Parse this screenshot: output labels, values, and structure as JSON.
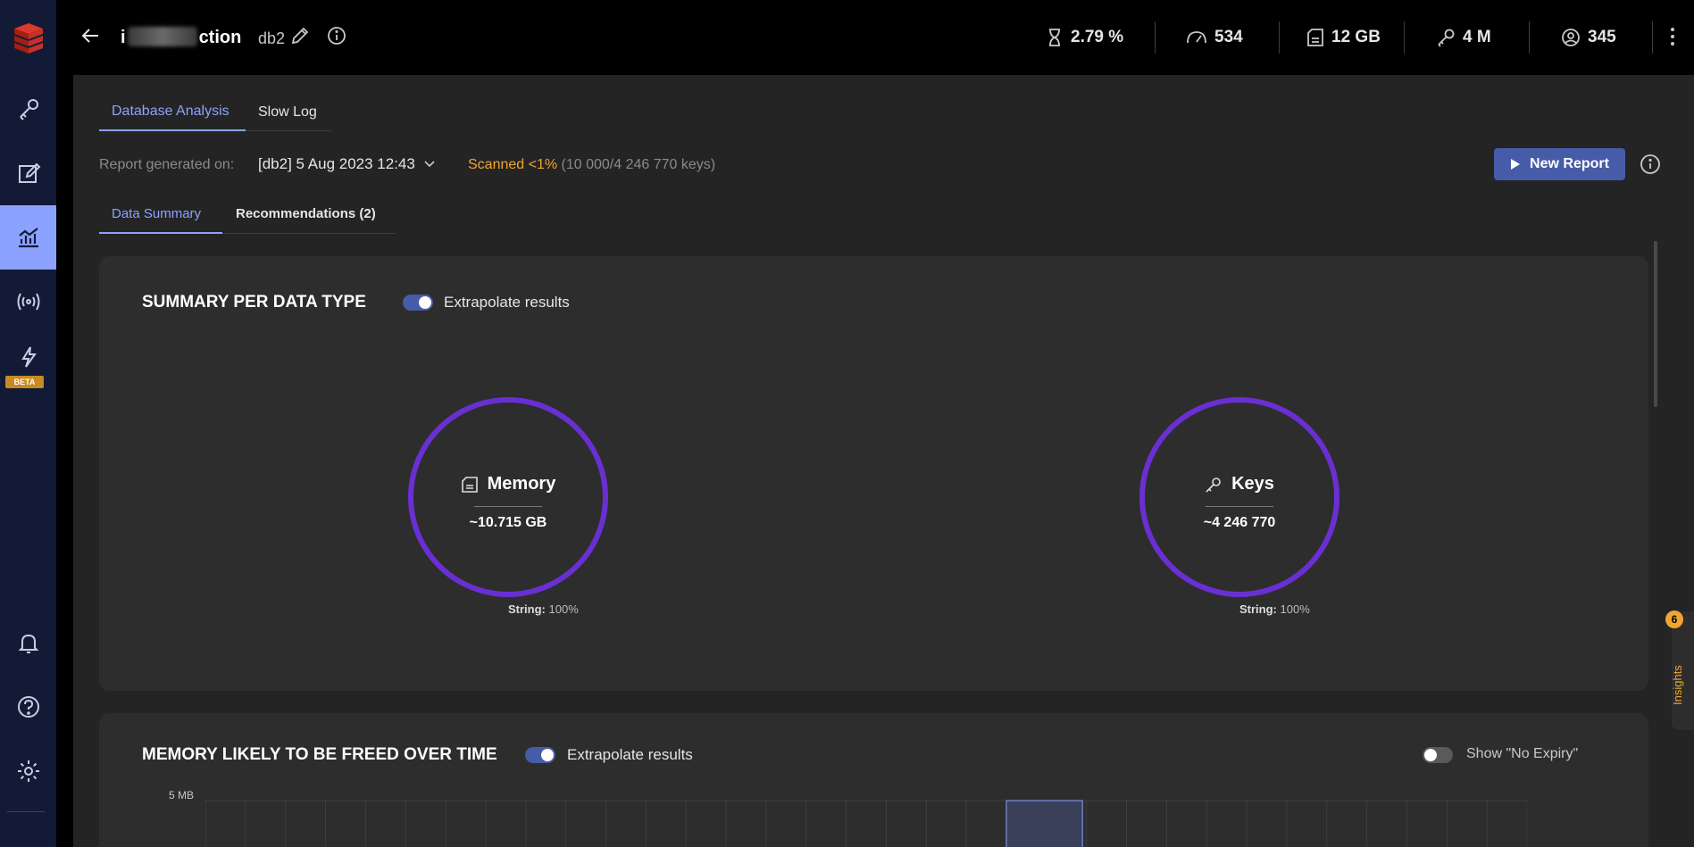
{
  "header": {
    "db_name_start": "i",
    "db_name_end": "ction",
    "db_index": "db2",
    "metrics": [
      {
        "icon": "cpu-icon",
        "value": "2.79 %"
      },
      {
        "icon": "speedometer-icon",
        "value": "534"
      },
      {
        "icon": "memory-icon",
        "value": "12 GB"
      },
      {
        "icon": "key-icon",
        "value": "4 M"
      },
      {
        "icon": "user-icon",
        "value": "345"
      }
    ]
  },
  "sidebar": {
    "beta_badge": "BETA",
    "items": [
      {
        "name": "browser",
        "icon": "key-icon"
      },
      {
        "name": "workbench",
        "icon": "edit-icon"
      },
      {
        "name": "analysis",
        "icon": "chart-icon",
        "active": true
      },
      {
        "name": "pubsub",
        "icon": "broadcast-icon"
      },
      {
        "name": "triggers",
        "icon": "lightning-icon"
      },
      {
        "name": "notifications",
        "icon": "bell-icon"
      },
      {
        "name": "help",
        "icon": "help-icon"
      },
      {
        "name": "settings",
        "icon": "gear-icon"
      }
    ]
  },
  "main": {
    "tabs": [
      {
        "label": "Database Analysis",
        "active": true
      },
      {
        "label": "Slow Log",
        "active": false
      }
    ],
    "report_label": "Report generated on:",
    "report_value": "[db2] 5 Aug 2023 12:43",
    "scanned_highlight": "Scanned <1%",
    "scanned_rest": "(10 000/4 246 770 keys)",
    "new_report_label": "New Report",
    "subtabs": [
      {
        "label": "Data Summary",
        "active": true
      },
      {
        "label": "Recommendations (2)",
        "active": false
      }
    ]
  },
  "summary_panel": {
    "title": "SUMMARY PER DATA TYPE",
    "toggle_label": "Extrapolate results",
    "toggle_on": true,
    "memory": {
      "title": "Memory",
      "value": "~10.715 GB",
      "caption_type": "String:",
      "caption_pct": "100%"
    },
    "keys": {
      "title": "Keys",
      "value": "~4 246 770",
      "caption_type": "String:",
      "caption_pct": "100%"
    },
    "ring_color": "#6a2fd3"
  },
  "memory_panel": {
    "title": "MEMORY LIKELY TO BE FREED OVER TIME",
    "toggle_label": "Extrapolate results",
    "toggle_on": true,
    "no_expiry_label": "Show \"No Expiry\"",
    "no_expiry_on": false,
    "y_axis_top_label": "5 MB"
  },
  "insights": {
    "badge": "6",
    "label": "Insights"
  },
  "colors": {
    "accent": "#8ba2ff",
    "button": "#475ca8",
    "warning": "#f0a532"
  }
}
